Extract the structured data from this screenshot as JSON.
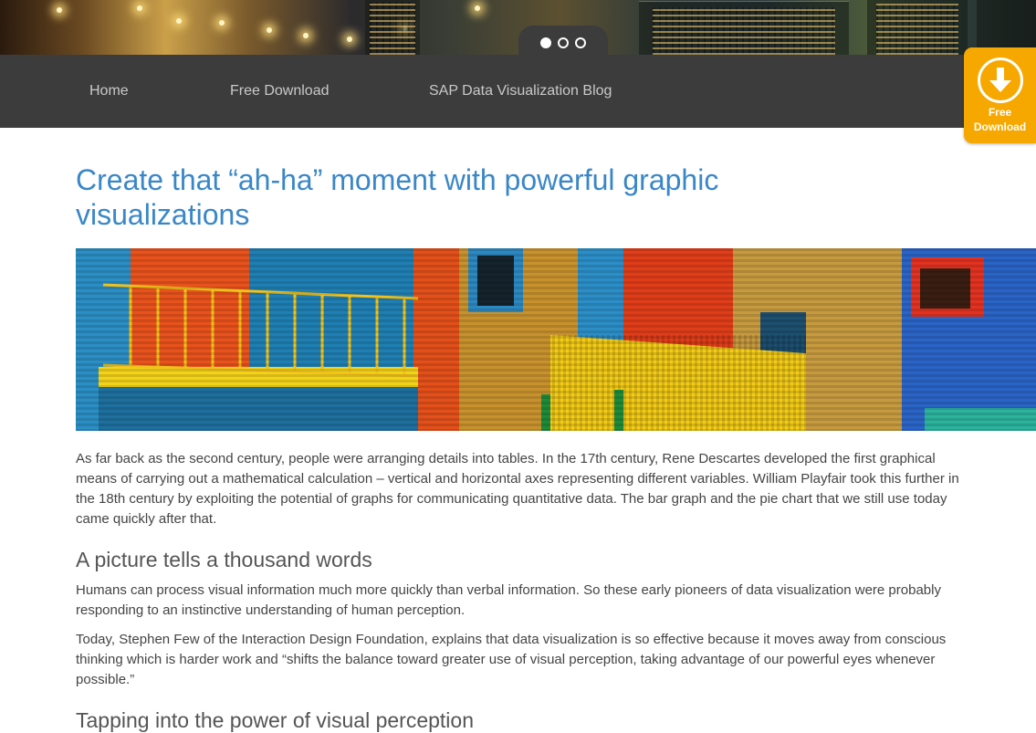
{
  "carousel": {
    "slide_count": 3,
    "active_index": 0
  },
  "nav": {
    "items": [
      {
        "label": "Home"
      },
      {
        "label": "Free Download"
      },
      {
        "label": "SAP Data Visualization Blog"
      }
    ]
  },
  "download_badge": {
    "label": "Free Download",
    "accent": "#f6a800"
  },
  "article": {
    "title": "Create that “ah-ha” moment with powerful graphic visualizations",
    "intro": "As far back as the second century, people were arranging details into tables. In the 17th century, Rene Descartes developed the first graphical means of carrying out a mathematical calculation – vertical and horizontal axes representing different variables. William Playfair took this further in the 18th century by exploiting the potential of graphs for communicating quantitative data. The bar graph and the pie chart that we still use today came quickly after that.",
    "section1_heading": "A picture tells a thousand words",
    "section1_p1": "Humans can process visual information much more quickly than verbal information. So these early pioneers of data visualization were probably responding to an instinctive understanding of human perception.",
    "section1_p2": "Today, Stephen Few of the Interaction Design Foundation, explains that data visualization is so effective because it moves away from conscious thinking which is harder work and “shifts the balance toward greater use of visual perception, taking advantage of our powerful eyes whenever possible.”",
    "section2_heading": "Tapping into the power of visual perception"
  },
  "colors": {
    "title_blue": "#3a87c8",
    "nav_bg": "#3c3c3c",
    "nav_text": "#c9c9c9",
    "body_text": "#444444"
  }
}
